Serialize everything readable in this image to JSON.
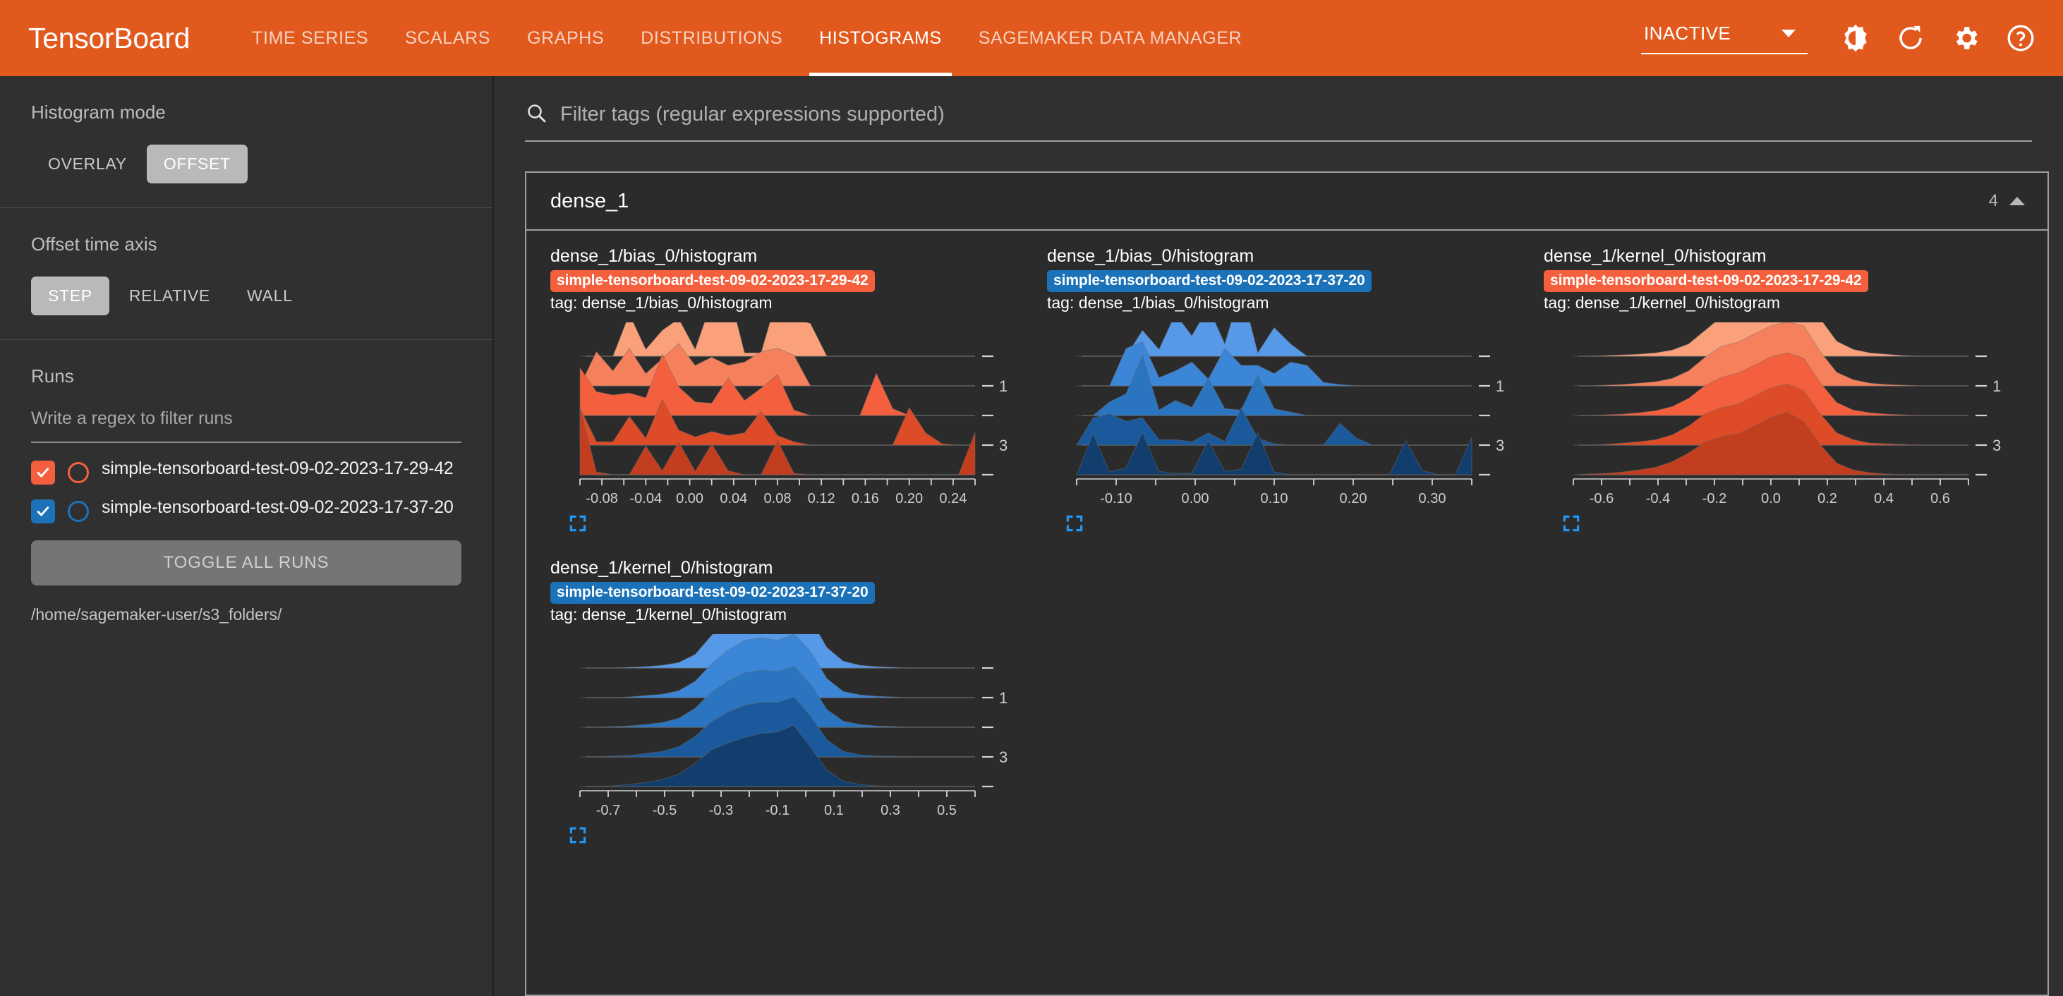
{
  "header": {
    "brand": "TensorBoard",
    "nav": [
      {
        "label": "TIME SERIES",
        "active": false
      },
      {
        "label": "SCALARS",
        "active": false
      },
      {
        "label": "GRAPHS",
        "active": false
      },
      {
        "label": "DISTRIBUTIONS",
        "active": false
      },
      {
        "label": "HISTOGRAMS",
        "active": true
      },
      {
        "label": "SAGEMAKER DATA MANAGER",
        "active": false
      }
    ],
    "status": "INACTIVE",
    "icons": [
      "brightness-icon",
      "refresh-icon",
      "settings-gear-icon",
      "help-icon"
    ],
    "bg_color": "#E2591E"
  },
  "sidebar": {
    "histogram_mode": {
      "title": "Histogram mode",
      "options": [
        "OVERLAY",
        "OFFSET"
      ],
      "selected": "OFFSET"
    },
    "offset_time_axis": {
      "title": "Offset time axis",
      "options": [
        "STEP",
        "RELATIVE",
        "WALL"
      ],
      "selected": "STEP"
    },
    "runs": {
      "title": "Runs",
      "filter_placeholder": "Write a regex to filter runs",
      "filter_value": "",
      "items": [
        {
          "label": "simple-tensorboard-test-09-02-2023-17-29-42",
          "checked": true,
          "color": "#F4603E"
        },
        {
          "label": "simple-tensorboard-test-09-02-2023-17-37-20",
          "checked": true,
          "color": "#1B72B8"
        }
      ],
      "toggle_all_label": "TOGGLE ALL RUNS",
      "logdir": "/home/sagemaker-user/s3_folders/"
    }
  },
  "main": {
    "search": {
      "placeholder": "Filter tags (regular expressions supported)",
      "value": ""
    },
    "card": {
      "title": "dense_1",
      "count": "4"
    }
  },
  "chart_data": [
    {
      "type": "area",
      "title": "dense_1/bias_0/histogram",
      "run": "simple-tensorboard-test-09-02-2023-17-29-42",
      "run_color": "#F4603E",
      "tag_label": "tag: dense_1/bias_0/histogram",
      "xlabel": "",
      "ylabel": "",
      "xticks": [
        "-0.08",
        "-0.04",
        "0.00",
        "0.04",
        "0.08",
        "0.12",
        "0.16",
        "0.20",
        "0.24"
      ],
      "xlim": [
        -0.1,
        0.25
      ],
      "yticks": [
        "",
        "1",
        "",
        "3",
        ""
      ],
      "grid": true,
      "palette": [
        "#FAA07A",
        "#F6805C",
        "#F4603E",
        "#DD4B27",
        "#C33E1E"
      ],
      "series": [
        {
          "step": 0,
          "values": [
            0.0,
            0.0,
            0.0,
            0.62,
            0.1,
            0.38,
            0.55,
            0.1,
            0.8,
            1.0,
            0.05,
            0.05,
            0.88,
            0.55,
            0.48,
            0.0,
            0.0,
            0.0,
            0.0,
            0.0,
            0.0,
            0.0,
            0.0,
            0.0,
            0.0
          ]
        },
        {
          "step": 1,
          "values": [
            0.0,
            0.5,
            0.22,
            0.55,
            0.18,
            0.4,
            0.62,
            0.3,
            0.42,
            0.3,
            0.35,
            0.5,
            0.55,
            0.45,
            0.0,
            0.0,
            0.0,
            0.0,
            0.0,
            0.0,
            0.0,
            0.0,
            0.0,
            0.0,
            0.0
          ]
        },
        {
          "step": 2,
          "values": [
            0.7,
            0.35,
            0.3,
            0.33,
            0.26,
            0.9,
            0.42,
            0.2,
            0.18,
            0.55,
            0.22,
            0.4,
            0.6,
            0.08,
            0.0,
            0.0,
            0.0,
            0.0,
            0.62,
            0.1,
            0.0,
            0.0,
            0.0,
            0.0,
            0.0
          ]
        },
        {
          "step": 3,
          "values": [
            0.55,
            0.05,
            0.05,
            0.42,
            0.1,
            0.68,
            0.22,
            0.12,
            0.2,
            0.14,
            0.18,
            0.5,
            0.14,
            0.05,
            0.0,
            0.0,
            0.0,
            0.0,
            0.0,
            0.0,
            0.55,
            0.18,
            0.02,
            0.0,
            0.0
          ]
        },
        {
          "step": 4,
          "values": [
            1.0,
            0.04,
            0.0,
            0.0,
            0.42,
            0.06,
            0.48,
            0.05,
            0.45,
            0.06,
            0.0,
            0.0,
            0.5,
            0.02,
            0.0,
            0.0,
            0.0,
            0.0,
            0.0,
            0.0,
            0.0,
            0.0,
            0.0,
            0.0,
            0.62
          ]
        }
      ]
    },
    {
      "type": "area",
      "title": "dense_1/bias_0/histogram",
      "run": "simple-tensorboard-test-09-02-2023-17-37-20",
      "run_color": "#1B72B8",
      "tag_label": "tag: dense_1/bias_0/histogram",
      "xlabel": "",
      "ylabel": "",
      "xticks": [
        "-0.10",
        "0.00",
        "0.10",
        "0.20",
        "0.30"
      ],
      "xlim": [
        -0.14,
        0.32
      ],
      "yticks": [
        "",
        "1",
        "",
        "3",
        ""
      ],
      "grid": true,
      "palette": [
        "#5599E8",
        "#3C86D8",
        "#2A74C0",
        "#1A5A9C",
        "#123E6E"
      ],
      "series": [
        {
          "step": 0,
          "values": [
            0.0,
            0.0,
            0.0,
            0.0,
            0.38,
            0.1,
            0.62,
            0.3,
            0.72,
            0.18,
            1.0,
            0.05,
            0.42,
            0.18,
            0.0,
            0.0,
            0.0,
            0.0,
            0.0,
            0.0,
            0.0,
            0.0,
            0.0,
            0.0,
            0.0
          ]
        },
        {
          "step": 1,
          "values": [
            0.0,
            0.0,
            0.0,
            0.55,
            0.65,
            0.12,
            0.22,
            0.35,
            0.1,
            0.55,
            0.3,
            0.3,
            0.18,
            0.35,
            0.3,
            0.05,
            0.02,
            0.0,
            0.0,
            0.0,
            0.0,
            0.0,
            0.0,
            0.0,
            0.0
          ]
        },
        {
          "step": 2,
          "values": [
            0.0,
            0.0,
            0.2,
            0.32,
            0.88,
            0.08,
            0.22,
            0.12,
            0.55,
            0.1,
            0.08,
            0.6,
            0.1,
            0.05,
            0.0,
            0.0,
            0.0,
            0.0,
            0.0,
            0.0,
            0.0,
            0.0,
            0.0,
            0.0,
            0.0
          ]
        },
        {
          "step": 3,
          "values": [
            0.0,
            0.4,
            0.46,
            0.35,
            0.4,
            0.08,
            0.08,
            0.05,
            0.18,
            0.05,
            0.55,
            0.1,
            0.02,
            0.0,
            0.0,
            0.0,
            0.32,
            0.1,
            0.0,
            0.0,
            0.0,
            0.0,
            0.0,
            0.0,
            0.0
          ]
        },
        {
          "step": 4,
          "values": [
            0.0,
            0.6,
            0.04,
            0.1,
            0.62,
            0.05,
            0.02,
            0.02,
            0.5,
            0.05,
            0.08,
            0.62,
            0.04,
            0.0,
            0.0,
            0.0,
            0.0,
            0.0,
            0.0,
            0.0,
            0.5,
            0.06,
            0.0,
            0.0,
            0.55
          ]
        }
      ]
    },
    {
      "type": "area",
      "title": "dense_1/kernel_0/histogram",
      "run": "simple-tensorboard-test-09-02-2023-17-29-42",
      "run_color": "#F4603E",
      "tag_label": "tag: dense_1/kernel_0/histogram",
      "xlabel": "",
      "ylabel": "",
      "xticks": [
        "-0.6",
        "-0.4",
        "-0.2",
        "0.0",
        "0.2",
        "0.4",
        "0.6"
      ],
      "xlim": [
        -0.72,
        0.68
      ],
      "yticks": [
        "",
        "1",
        "",
        "3",
        ""
      ],
      "grid": true,
      "palette": [
        "#FAA07A",
        "#F6805C",
        "#F4603E",
        "#DD4B27",
        "#C33E1E"
      ],
      "series": [
        {
          "step": 0,
          "values": [
            0.0,
            0.0,
            0.01,
            0.02,
            0.03,
            0.05,
            0.09,
            0.18,
            0.38,
            0.58,
            0.66,
            0.78,
            0.92,
            1.0,
            0.96,
            0.55,
            0.22,
            0.1,
            0.05,
            0.03,
            0.01,
            0.0,
            0.0,
            0.0,
            0.0
          ]
        },
        {
          "step": 1,
          "values": [
            0.0,
            0.0,
            0.01,
            0.02,
            0.04,
            0.06,
            0.11,
            0.22,
            0.42,
            0.58,
            0.64,
            0.76,
            0.88,
            0.94,
            0.88,
            0.5,
            0.2,
            0.09,
            0.04,
            0.02,
            0.01,
            0.0,
            0.0,
            0.0,
            0.0
          ]
        },
        {
          "step": 2,
          "values": [
            0.0,
            0.0,
            0.01,
            0.02,
            0.04,
            0.07,
            0.13,
            0.25,
            0.44,
            0.56,
            0.62,
            0.74,
            0.86,
            0.92,
            0.84,
            0.48,
            0.19,
            0.08,
            0.04,
            0.02,
            0.01,
            0.0,
            0.0,
            0.0,
            0.0
          ]
        },
        {
          "step": 3,
          "values": [
            0.0,
            0.0,
            0.01,
            0.03,
            0.05,
            0.08,
            0.15,
            0.28,
            0.46,
            0.55,
            0.6,
            0.72,
            0.84,
            0.9,
            0.8,
            0.46,
            0.18,
            0.08,
            0.03,
            0.02,
            0.01,
            0.0,
            0.0,
            0.0,
            0.0
          ]
        },
        {
          "step": 4,
          "values": [
            0.0,
            0.01,
            0.02,
            0.04,
            0.07,
            0.11,
            0.19,
            0.32,
            0.48,
            0.56,
            0.6,
            0.72,
            0.84,
            0.92,
            0.78,
            0.44,
            0.17,
            0.07,
            0.03,
            0.01,
            0.0,
            0.0,
            0.0,
            0.0,
            0.0
          ]
        }
      ]
    },
    {
      "type": "area",
      "title": "dense_1/kernel_0/histogram",
      "run": "simple-tensorboard-test-09-02-2023-17-37-20",
      "run_color": "#1B72B8",
      "tag_label": "tag: dense_1/kernel_0/histogram",
      "xlabel": "",
      "ylabel": "",
      "xticks": [
        "-0.7",
        "-0.5",
        "-0.3",
        "-0.1",
        "0.1",
        "0.3",
        "0.5"
      ],
      "xlim": [
        -0.85,
        0.62
      ],
      "yticks": [
        "",
        "1",
        "",
        "3",
        ""
      ],
      "grid": true,
      "palette": [
        "#5599E8",
        "#3C86D8",
        "#2A74C0",
        "#1A5A9C",
        "#123E6E"
      ],
      "series": [
        {
          "step": 0,
          "values": [
            0.0,
            0.0,
            0.0,
            0.01,
            0.02,
            0.04,
            0.08,
            0.2,
            0.48,
            0.72,
            0.88,
            0.92,
            0.85,
            1.0,
            0.72,
            0.3,
            0.1,
            0.04,
            0.02,
            0.01,
            0.0,
            0.0,
            0.0,
            0.0,
            0.0
          ]
        },
        {
          "step": 1,
          "values": [
            0.0,
            0.0,
            0.0,
            0.01,
            0.03,
            0.05,
            0.1,
            0.24,
            0.5,
            0.7,
            0.84,
            0.88,
            0.84,
            0.94,
            0.68,
            0.28,
            0.09,
            0.04,
            0.02,
            0.01,
            0.0,
            0.0,
            0.0,
            0.0,
            0.0
          ]
        },
        {
          "step": 2,
          "values": [
            0.0,
            0.0,
            0.01,
            0.02,
            0.04,
            0.07,
            0.13,
            0.28,
            0.52,
            0.68,
            0.8,
            0.84,
            0.82,
            0.9,
            0.64,
            0.26,
            0.09,
            0.04,
            0.02,
            0.01,
            0.0,
            0.0,
            0.0,
            0.0,
            0.0
          ]
        },
        {
          "step": 3,
          "values": [
            0.0,
            0.0,
            0.01,
            0.02,
            0.05,
            0.08,
            0.15,
            0.3,
            0.52,
            0.66,
            0.76,
            0.8,
            0.8,
            0.88,
            0.6,
            0.25,
            0.08,
            0.03,
            0.01,
            0.01,
            0.0,
            0.0,
            0.0,
            0.0,
            0.0
          ]
        },
        {
          "step": 4,
          "values": [
            0.0,
            0.0,
            0.01,
            0.03,
            0.06,
            0.1,
            0.18,
            0.34,
            0.54,
            0.64,
            0.72,
            0.78,
            0.8,
            0.9,
            0.58,
            0.24,
            0.08,
            0.03,
            0.01,
            0.0,
            0.0,
            0.0,
            0.0,
            0.0,
            0.0
          ]
        }
      ]
    }
  ]
}
